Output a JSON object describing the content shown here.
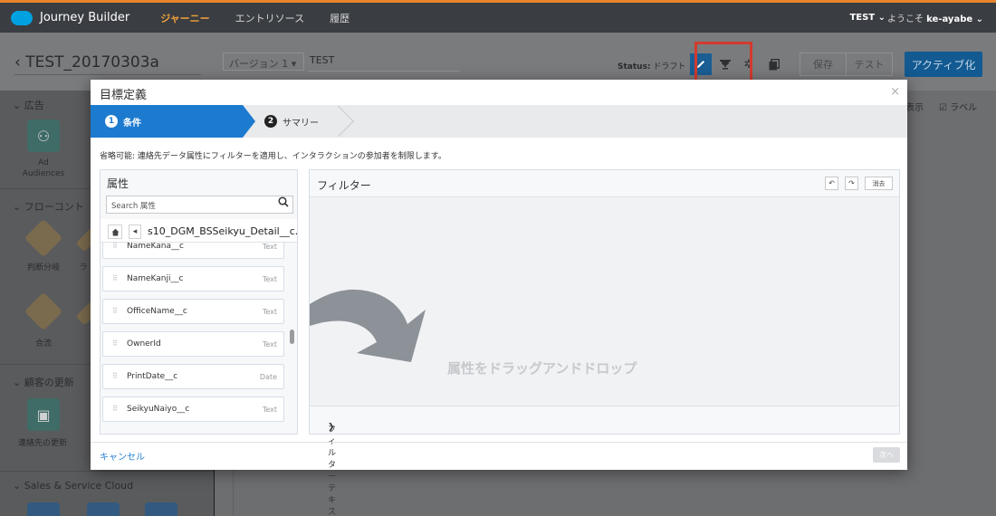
{
  "topnav": {
    "brand": "Journey Builder",
    "items": [
      "ジャーニー",
      "エントリソース",
      "履歴"
    ],
    "org": "TEST ⌄",
    "welcome_prefix": "ようこそ",
    "user": "ke-ayabe ⌄"
  },
  "header": {
    "journey_name": "‹ TEST_20170303a",
    "version": "バージョン 1 ▾",
    "description": "TEST",
    "status_label": "Status:",
    "status_value": "ドラフト",
    "save": "保存",
    "test": "テスト",
    "activate": "アクティブ化"
  },
  "palette": {
    "sections": [
      {
        "label": "⌄ 広告",
        "items": [
          {
            "label": "Ad Audiences",
            "icon": "ad-audiences-icon"
          }
        ]
      },
      {
        "label": "⌄ フローコント",
        "items": [
          {
            "label": "判断分岐",
            "icon": "decision-split-icon"
          },
          {
            "label": "合流",
            "icon": "join-icon"
          }
        ],
        "partial_label": "ラ"
      },
      {
        "label": "⌄ 顧客の更新",
        "items": [
          {
            "label": "連絡先の更新",
            "icon": "update-contact-icon"
          }
        ]
      },
      {
        "label": "⌄ Sales & Service Cloud",
        "items": []
      }
    ]
  },
  "canvas": {
    "show_partial": "表示",
    "label_option": "ラベル"
  },
  "modal": {
    "title": "目標定義",
    "close": "×",
    "steps": [
      {
        "num": "1",
        "label": "条件"
      },
      {
        "num": "2",
        "label": "サマリー"
      }
    ],
    "description": "省略可能: 連絡先データ属性にフィルターを適用し、インタラクションの参加者を制限します。",
    "attributes": {
      "title": "属性",
      "search_placeholder": "Search 属性",
      "breadcrumb": "s10_DGM_BSSeikyu_Detail__c...",
      "rows": [
        {
          "name": "NameKana__c",
          "type": "Text"
        },
        {
          "name": "NameKanji__c",
          "type": "Text"
        },
        {
          "name": "OfficeName__c",
          "type": "Text"
        },
        {
          "name": "OwnerId",
          "type": "Text"
        },
        {
          "name": "PrintDate__c",
          "type": "Date"
        },
        {
          "name": "SeikyuNaiyo__c",
          "type": "Text"
        }
      ]
    },
    "filter": {
      "title": "フィルター",
      "clear": "消去",
      "drop_hint": "属性をドラッグアンドドロップ",
      "filter_text": "フィルターテキスト"
    },
    "cancel": "キャンセル",
    "next": "次へ"
  },
  "colors": {
    "accent": "#1d7bcf",
    "topnav_bg": "#3a3d42",
    "active_nav": "#f0a03a",
    "highlight_box": "#d23a2e"
  }
}
